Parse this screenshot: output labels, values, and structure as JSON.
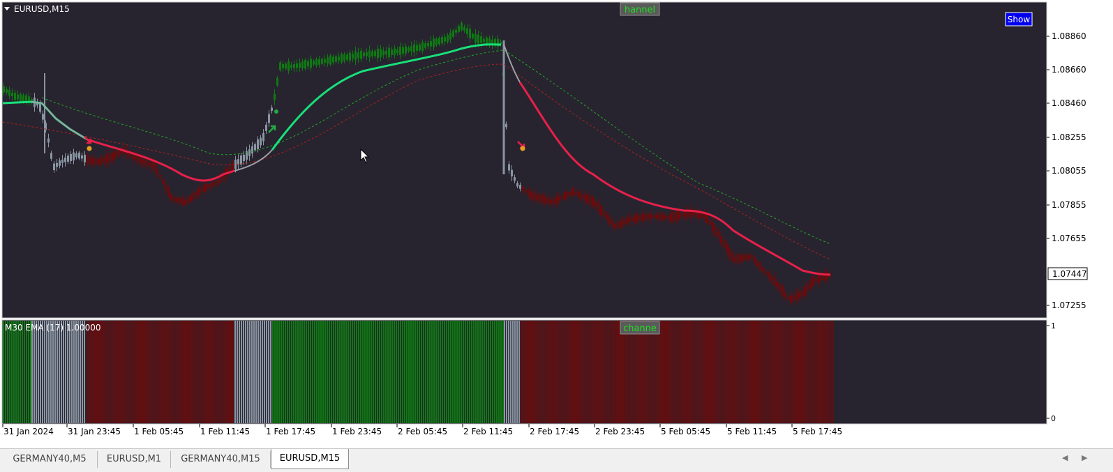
{
  "main_chart": {
    "symbol_label": "EURUSD,M15",
    "channel_label": "hannel",
    "show_button": "Show",
    "current_price": "1.07447",
    "price_ticks": [
      "1.08860",
      "1.08660",
      "1.08460",
      "1.08255",
      "1.08055",
      "1.07855",
      "1.07655",
      "1.07255"
    ]
  },
  "sub_chart": {
    "label": "M30 EMA (17) 1.00000",
    "channel_label": "channe",
    "axis_top": "1",
    "axis_bottom": "0"
  },
  "time_axis": [
    "31 Jan 2024",
    "31 Jan 23:45",
    "1 Feb 05:45",
    "1 Feb 11:45",
    "1 Feb 17:45",
    "1 Feb 23:45",
    "2 Feb 05:45",
    "2 Feb 11:45",
    "2 Feb 17:45",
    "2 Feb 23:45",
    "5 Feb 05:45",
    "5 Feb 11:45",
    "5 Feb 17:45"
  ],
  "tabs": [
    {
      "label": "GERMANY40,M5",
      "active": false
    },
    {
      "label": "EURUSD,M1",
      "active": false
    },
    {
      "label": "GERMANY40,M15",
      "active": false
    },
    {
      "label": "EURUSD,M15",
      "active": true
    }
  ],
  "colors": {
    "background": "#27242f",
    "bull_candle": "#0e7a12",
    "bear_candle": "#6e0a0a",
    "neutral_candle": "#8a95a3",
    "ema_up": "#18e07a",
    "ema_down": "#e8204a",
    "ema_neutral": "#a0a0a8"
  }
}
